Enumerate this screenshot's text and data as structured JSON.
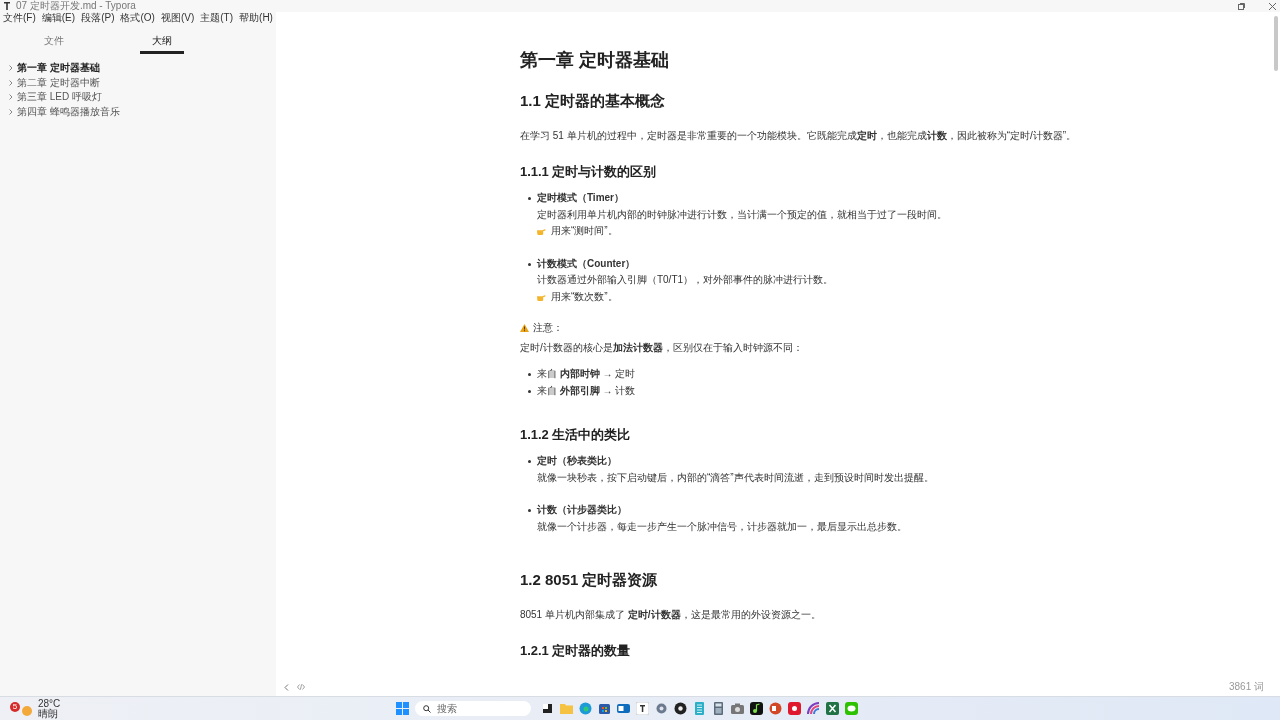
{
  "window": {
    "title": "07 定时器开发.md - Typora"
  },
  "menu": [
    "文件(F)",
    "编辑(E)",
    "段落(P)",
    "格式(O)",
    "视图(V)",
    "主题(T)",
    "帮助(H)"
  ],
  "sidebar": {
    "tabs": [
      {
        "label": "文件",
        "selected": false
      },
      {
        "label": "大纲",
        "selected": true
      }
    ],
    "outline": [
      {
        "label": "第一章 定时器基础",
        "selected": true
      },
      {
        "label": "第二章 定时器中断",
        "selected": false
      },
      {
        "label": "第三章 LED 呼吸灯",
        "selected": false
      },
      {
        "label": "第四章 蜂鸣器播放音乐",
        "selected": false
      }
    ]
  },
  "document": [
    {
      "kind": "h1",
      "text": "第一章 定时器基础"
    },
    {
      "kind": "h2",
      "text": "1.1 定时器的基本概念"
    },
    {
      "kind": "p",
      "text": "在学习 51 单片机的过程中，定时器是非常重要的一个功能模块。它既能完成**定时**，也能完成**计数**，因此被称为“定时/计数器”。"
    },
    {
      "kind": "h3",
      "text": "1.1.1 定时与计数的区别"
    },
    {
      "kind": "item",
      "title": "定时模式（Timer）",
      "text": "定时器利用单片机内部的时钟脉冲进行计数，当计满一个预定的值，就相当于过了一段时间。",
      "hint": "用来“测时间”。"
    },
    {
      "kind": "item",
      "title": "计数模式（Counter）",
      "text": "计数器通过外部输入引脚（T0/T1），对外部事件的脉冲进行计数。",
      "hint": "用来“数次数”。"
    },
    {
      "kind": "note",
      "text": "注意："
    },
    {
      "kind": "p",
      "text": "定时/计数器的核心是**加法计数器**，区别仅在于输入时钟源不同："
    },
    {
      "kind": "bullet",
      "text": "来自 **内部时钟** → 定时"
    },
    {
      "kind": "bullet",
      "text": "来自 **外部引脚** → 计数"
    },
    {
      "kind": "h3",
      "text": "1.1.2 生活中的类比"
    },
    {
      "kind": "item",
      "title": "定时（秒表类比）",
      "text": "就像一块秒表，按下启动键后，内部的“滴答”声代表时间流逝，走到预设时间时发出提醒。"
    },
    {
      "kind": "item",
      "title": "计数（计步器类比）",
      "text": "就像一个计步器，每走一步产生一个脉冲信号，计步器就加一，最后显示出总步数。"
    },
    {
      "kind": "h2",
      "text": "1.2 8051 定时器资源"
    },
    {
      "kind": "p",
      "text": "8051 单片机内部集成了 **定时/计数器**，这是最常用的外设资源之一。"
    },
    {
      "kind": "h3",
      "text": "1.2.1 定时器的数量"
    }
  ],
  "footer": {
    "word_count": "3861 词"
  },
  "taskbar": {
    "weather_badge": "5",
    "temperature": "28°C",
    "weather": "晴朗",
    "search_placeholder": "搜索"
  }
}
